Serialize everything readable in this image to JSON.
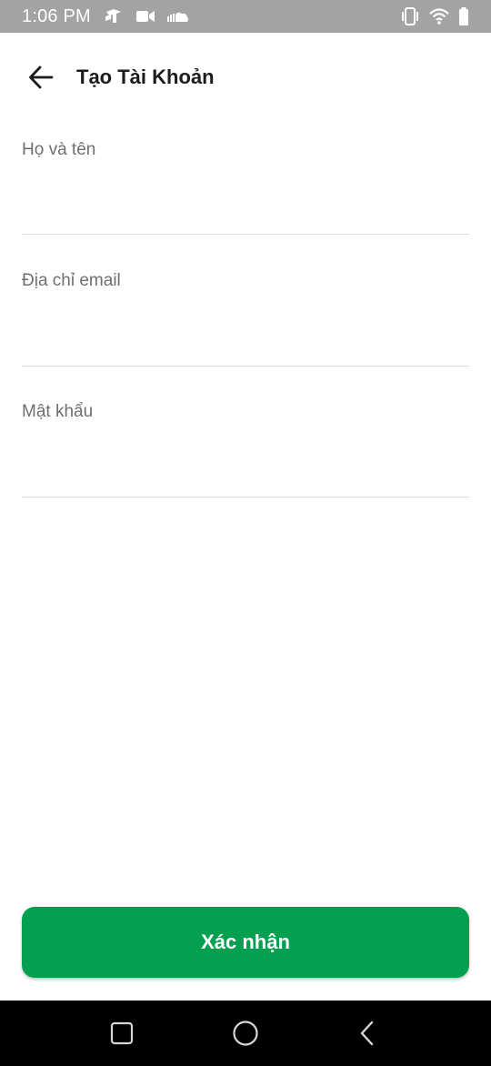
{
  "status_bar": {
    "time": "1:06 PM",
    "icons_left": [
      "app-notification-icon",
      "video-camera-icon",
      "cloud-icon"
    ],
    "icons_right": [
      "vibrate-icon",
      "wifi-icon",
      "battery-icon"
    ]
  },
  "header": {
    "title": "Tạo Tài Khoản",
    "back_icon": "arrow-left-icon"
  },
  "form": {
    "fields": [
      {
        "label": "Họ và tên",
        "value": ""
      },
      {
        "label": "Địa chỉ email",
        "value": ""
      },
      {
        "label": "Mật khẩu",
        "value": ""
      }
    ]
  },
  "submit": {
    "label": "Xác nhận"
  },
  "colors": {
    "accent": "#03a050",
    "status_bar": "#a3a3a3",
    "nav_bar": "#000000"
  },
  "nav_bar": {
    "buttons": [
      "recents-icon",
      "home-icon",
      "back-triangle-icon"
    ]
  }
}
